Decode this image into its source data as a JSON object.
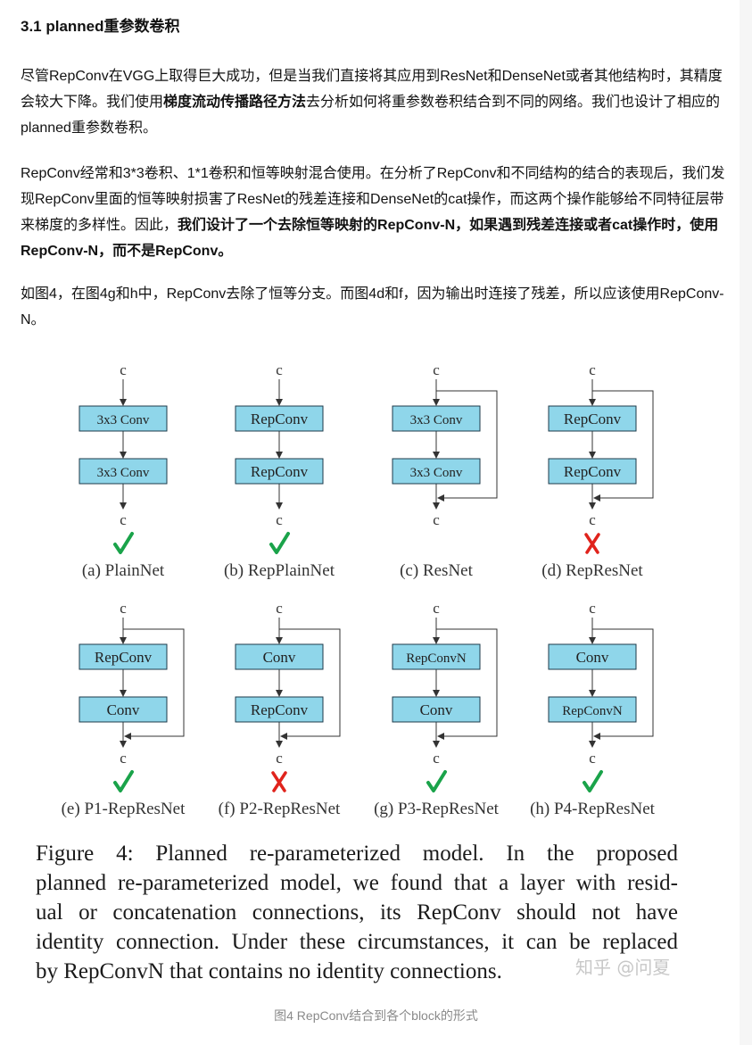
{
  "section_title": "3.1 planned重参数卷积",
  "paragraphs": [
    {
      "parts": [
        {
          "t": "尽管RepConv在VGG上取得巨大成功，但是当我们直接将其应用到ResNet和DenseNet或者其他结构时，其精度会较大下降。我们使用",
          "b": false
        },
        {
          "t": "梯度流动传播路径方法",
          "b": true
        },
        {
          "t": "去分析如何将重参数卷积结合到不同的网络。我们也设计了相应的planned重参数卷积。",
          "b": false
        }
      ]
    },
    {
      "parts": [
        {
          "t": "RepConv经常和3*3卷积、1*1卷积和恒等映射混合使用。在分析了RepConv和不同结构的结合的表现后，我们发现RepConv里面的恒等映射损害了ResNet的残差连接和DenseNet的cat操作，而这两个操作能够给不同特征层带来梯度的多样性。因此，",
          "b": false
        },
        {
          "t": "我们设计了一个去除恒等映射的RepConv-N，如果遇到残差连接或者cat操作时，使用RepConv-N，而不是RepConv。",
          "b": true
        }
      ]
    },
    {
      "parts": [
        {
          "t": "如图4，在图4g和h中，RepConv去除了恒等分支。而图4d和f，因为输出时连接了残差，所以应该使用RepConv-N。",
          "b": false
        }
      ]
    }
  ],
  "figure": {
    "node_label": "c",
    "panels": [
      {
        "top": "3x3 Conv",
        "bottom": "3x3 Conv",
        "residual": false,
        "mark": "check",
        "label": "(a) PlainNet"
      },
      {
        "top": "RepConv",
        "bottom": "RepConv",
        "residual": false,
        "mark": "check",
        "label": "(b) RepPlainNet"
      },
      {
        "top": "3x3 Conv",
        "bottom": "3x3 Conv",
        "residual": true,
        "mark": "none",
        "label": "(c) ResNet"
      },
      {
        "top": "RepConv",
        "bottom": "RepConv",
        "residual": true,
        "mark": "cross",
        "label": "(d) RepResNet"
      },
      {
        "top": "RepConv",
        "bottom": "Conv",
        "residual": true,
        "mark": "check",
        "label": "(e) P1-RepResNet"
      },
      {
        "top": "Conv",
        "bottom": "RepConv",
        "residual": true,
        "mark": "cross",
        "label": "(f) P2-RepResNet"
      },
      {
        "top": "RepConvN",
        "bottom": "Conv",
        "residual": true,
        "mark": "check",
        "label": "(g) P3-RepResNet"
      },
      {
        "top": "Conv",
        "bottom": "RepConvN",
        "residual": true,
        "mark": "check",
        "label": "(h) P4-RepResNet"
      }
    ],
    "box_fill": "#8fd6ea",
    "box_stroke": "#1c3a4a",
    "check_color": "#1aa34a",
    "cross_color": "#e0231c",
    "caption_lines": [
      "Figure 4:  Planned re-parameterized model.  In the proposed",
      "planned re-parameterized model, we found that a layer with resid-",
      "ual or concatenation connections, its RepConv should not have",
      "identity connection. Under these circumstances, it can be replaced",
      "by RepConvN that contains no identity connections."
    ],
    "watermark": "知乎 @问夏"
  },
  "image_caption": "图4 RepConv结合到各个block的形式"
}
